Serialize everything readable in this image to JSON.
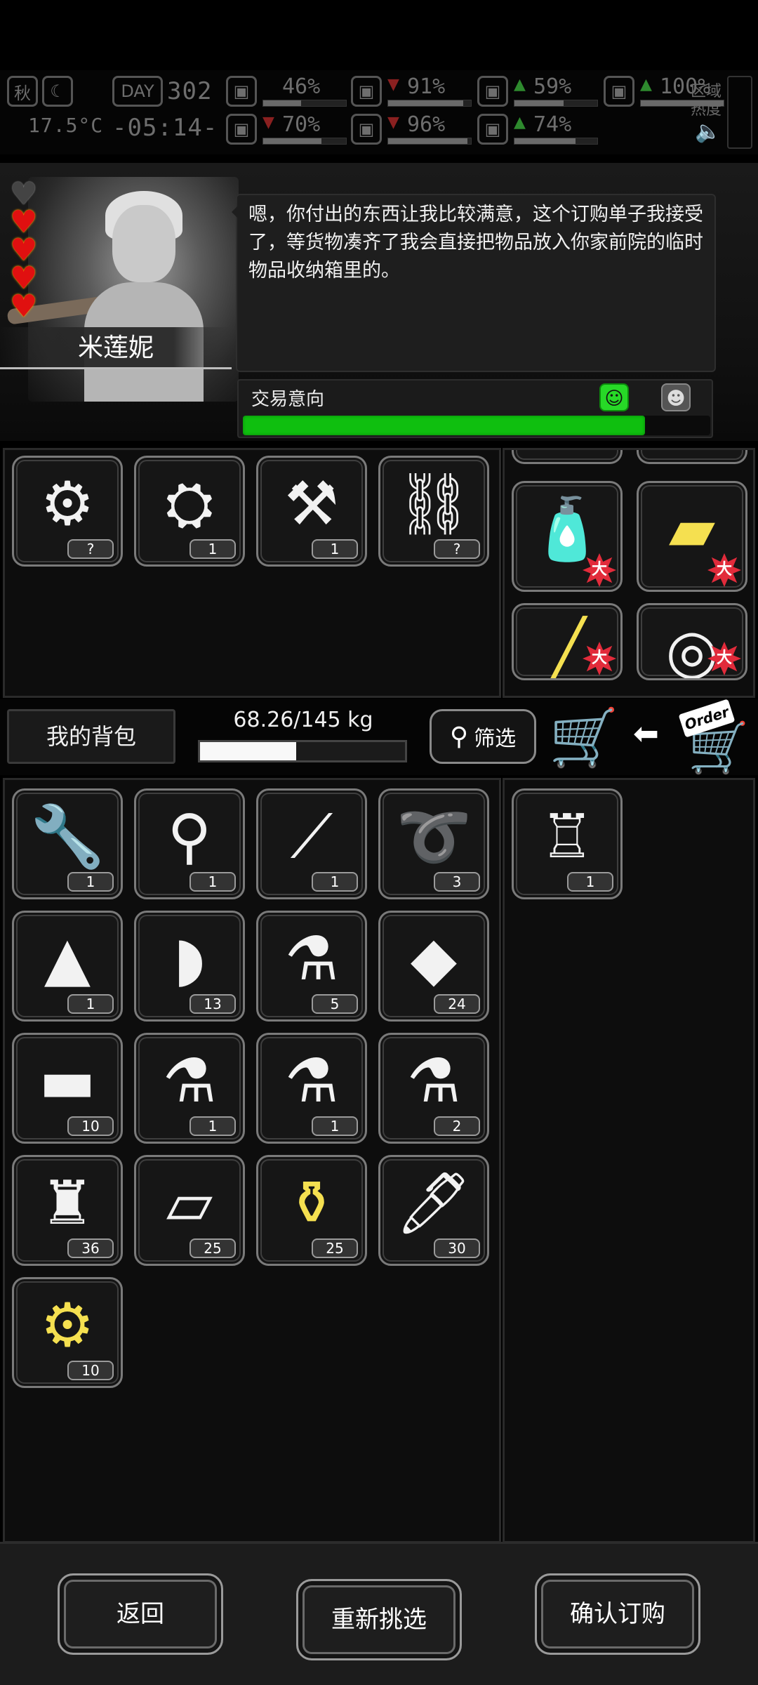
{
  "status": {
    "season": "秋",
    "day_label": "DAY",
    "day": "302",
    "temperature": "17.5°C",
    "time": "-05:14-",
    "region_label": "区域热度",
    "stats": [
      {
        "icon": "medkit-icon",
        "value": "46%",
        "fill": 0.46,
        "trend": ""
      },
      {
        "icon": "stomach-icon",
        "value": "91%",
        "fill": 0.91,
        "trend": "down"
      },
      {
        "icon": "battery-icon",
        "value": "59%",
        "fill": 0.59,
        "trend": "up"
      },
      {
        "icon": "brain-icon",
        "value": "70%",
        "fill": 0.7,
        "trend": "down"
      },
      {
        "icon": "water-drop-icon",
        "value": "96%",
        "fill": 0.96,
        "trend": "down"
      },
      {
        "icon": "heart-icon",
        "value": "74%",
        "fill": 0.74,
        "trend": "up"
      },
      {
        "icon": "person-icon",
        "value": "100%",
        "fill": 1.0,
        "trend": "up"
      }
    ]
  },
  "trader": {
    "name": "米莲妮",
    "hearts_total": 5,
    "hearts_filled": 4,
    "dialog": "嗯，你付出的东西让我比较满意，这个订购单子我接受了，等货物凑齐了我会直接把物品放入你家前院的临时物品收纳箱里的。",
    "intent_label": "交易意向",
    "intent_level": 0.86
  },
  "offer_items": [
    {
      "name": "blueprint-icon",
      "glyph": "⚙",
      "qty": "?"
    },
    {
      "name": "engine-part-icon",
      "glyph": "⛭",
      "qty": "1"
    },
    {
      "name": "machine-vise-icon",
      "glyph": "⚒",
      "qty": "1"
    },
    {
      "name": "seat-blueprint-icon",
      "glyph": "⛓",
      "qty": "?"
    }
  ],
  "order_items": [
    {
      "name": "water-bottle-icon",
      "glyph": "🧴",
      "badge": "大",
      "yellow": false
    },
    {
      "name": "cloth-icon",
      "glyph": "▰",
      "badge": "大",
      "yellow": true
    },
    {
      "name": "bamboo-icon",
      "glyph": "╱",
      "badge": "大",
      "yellow": true
    },
    {
      "name": "paper-roll-icon",
      "glyph": "◎",
      "badge": "大",
      "yellow": false
    }
  ],
  "toolbar": {
    "backpack_label": "我的背包",
    "weight_text": "68.26/145 kg",
    "weight_fraction": 0.47,
    "filter_label": "筛选",
    "order_tag": "Order"
  },
  "backpack_items": [
    {
      "name": "pipe-wrench-icon",
      "glyph": "🔧",
      "qty": "1",
      "yellow": false
    },
    {
      "name": "shovel-icon",
      "glyph": "⚲",
      "qty": "1",
      "yellow": false
    },
    {
      "name": "lockpick-icon",
      "glyph": "⟋",
      "qty": "1",
      "yellow": false
    },
    {
      "name": "rope-icon",
      "glyph": "➰",
      "qty": "3",
      "yellow": false
    },
    {
      "name": "torn-cloth-icon",
      "glyph": "▲",
      "qty": "1",
      "yellow": false
    },
    {
      "name": "bandage-icon",
      "glyph": "◗",
      "qty": "13",
      "yellow": false
    },
    {
      "name": "test-tube-ii-icon",
      "glyph": "⚗",
      "qty": "5",
      "yellow": false
    },
    {
      "name": "raw-meat-icon",
      "glyph": "◆",
      "qty": "24",
      "yellow": false
    },
    {
      "name": "towels-icon",
      "glyph": "▬",
      "qty": "10",
      "yellow": false
    },
    {
      "name": "test-tube-i-icon",
      "glyph": "⚗",
      "qty": "1",
      "yellow": false
    },
    {
      "name": "test-tube-iv-icon",
      "glyph": "⚗",
      "qty": "1",
      "yellow": false
    },
    {
      "name": "test-tube-iii-icon",
      "glyph": "⚗",
      "qty": "2",
      "yellow": false
    },
    {
      "name": "spray-cans-icon",
      "glyph": "♜",
      "qty": "36",
      "yellow": false
    },
    {
      "name": "cloth-sheet-icon",
      "glyph": "▱",
      "qty": "25",
      "yellow": false
    },
    {
      "name": "flask-icon",
      "glyph": "⚱",
      "qty": "25",
      "yellow": true
    },
    {
      "name": "glue-bottle-icon",
      "glyph": "🖊",
      "qty": "30",
      "yellow": false
    },
    {
      "name": "gears-icon",
      "glyph": "⚙",
      "qty": "10",
      "yellow": true
    }
  ],
  "selected_items": [
    {
      "name": "robot-part-icon",
      "glyph": "♖",
      "qty": "1"
    }
  ],
  "buttons": {
    "back": "返回",
    "reselect": "重新挑选",
    "confirm": "确认订购"
  }
}
